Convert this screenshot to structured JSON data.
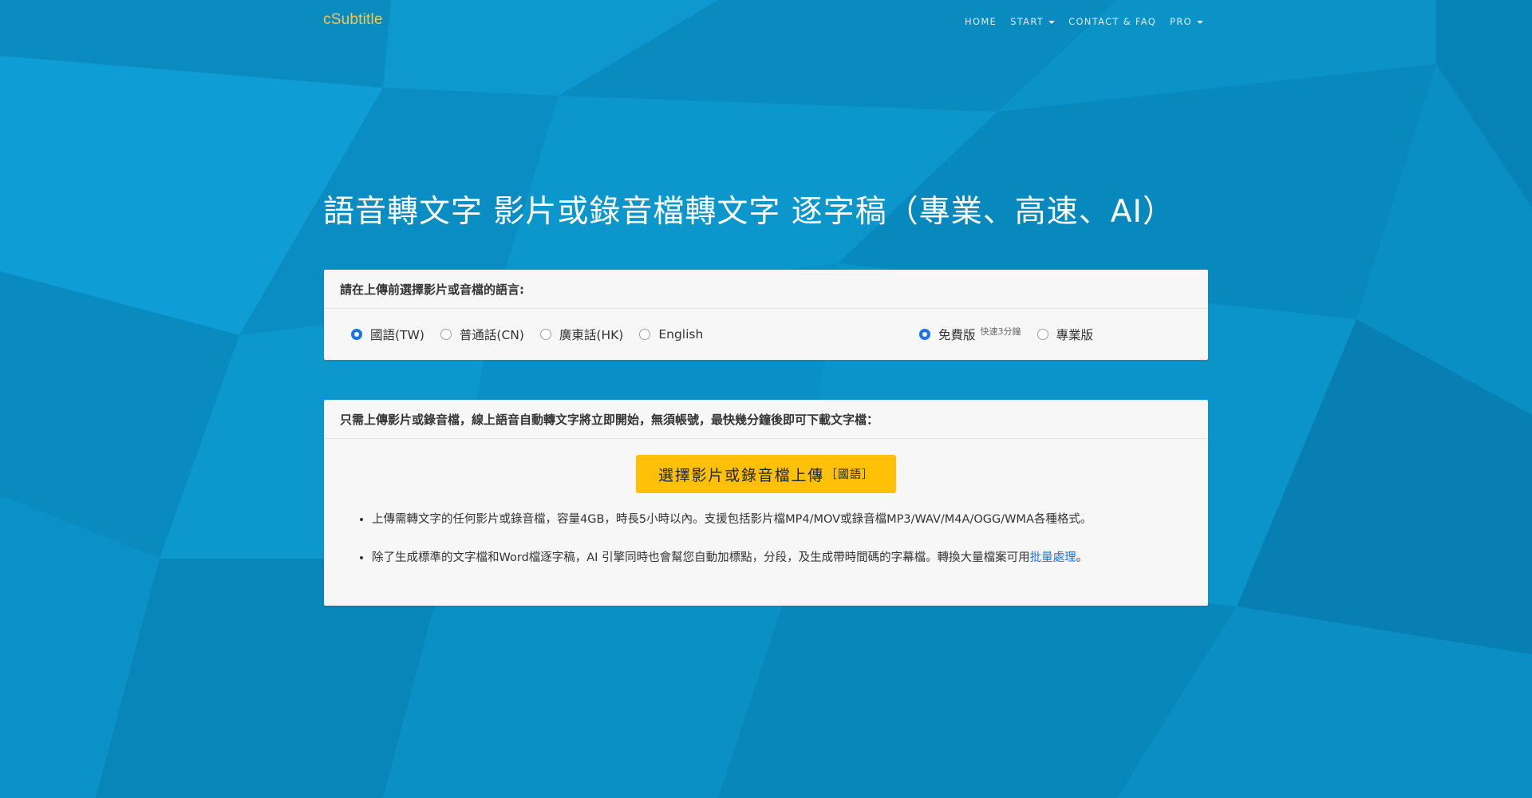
{
  "brand": "cSubtitle",
  "nav": {
    "home": "HOME",
    "start": "START",
    "contact": "CONTACT & FAQ",
    "pro": "PRO"
  },
  "hero": {
    "title": "語音轉文字 影片或錄音檔轉文字 逐字稿（專業、高速、AI）"
  },
  "language_card": {
    "header": "請在上傳前選擇影片或音檔的語言:",
    "languages": [
      {
        "label": "國語(TW)",
        "checked": true
      },
      {
        "label": "普通話(CN)",
        "checked": false
      },
      {
        "label": "廣東話(HK)",
        "checked": false
      },
      {
        "label": "English",
        "checked": false
      }
    ],
    "plans": [
      {
        "label": "免費版",
        "note": "快速3分鐘",
        "checked": true
      },
      {
        "label": "專業版",
        "checked": false
      }
    ]
  },
  "upload_card": {
    "header": "只需上傳影片或錄音檔，線上語音自動轉文字將立即開始，無須帳號，最快幾分鐘後即可下載文字檔：",
    "button_label": "選擇影片或錄音檔上傳",
    "button_tag": "［國語］",
    "notes": [
      "上傳需轉文字的任何影片或錄音檔，容量4GB，時長5小時以內。支援包括影片檔MP4/MOV或錄音檔MP3/WAV/M4A/OGG/WMA各種格式。",
      "除了生成標準的文字檔和Word檔逐字稿，AI 引擎同時也會幫您自動加標點，分段，及生成帶時間碼的字幕檔。轉換大量檔案可用"
    ],
    "batch_link": "批量處理",
    "note2_end": "。"
  },
  "colors": {
    "background": "#0a8fc4",
    "brand": "#f2c94c",
    "upload_button": "#ffc107",
    "radio_checked": "#1a73e8",
    "link": "#1a73e8"
  }
}
